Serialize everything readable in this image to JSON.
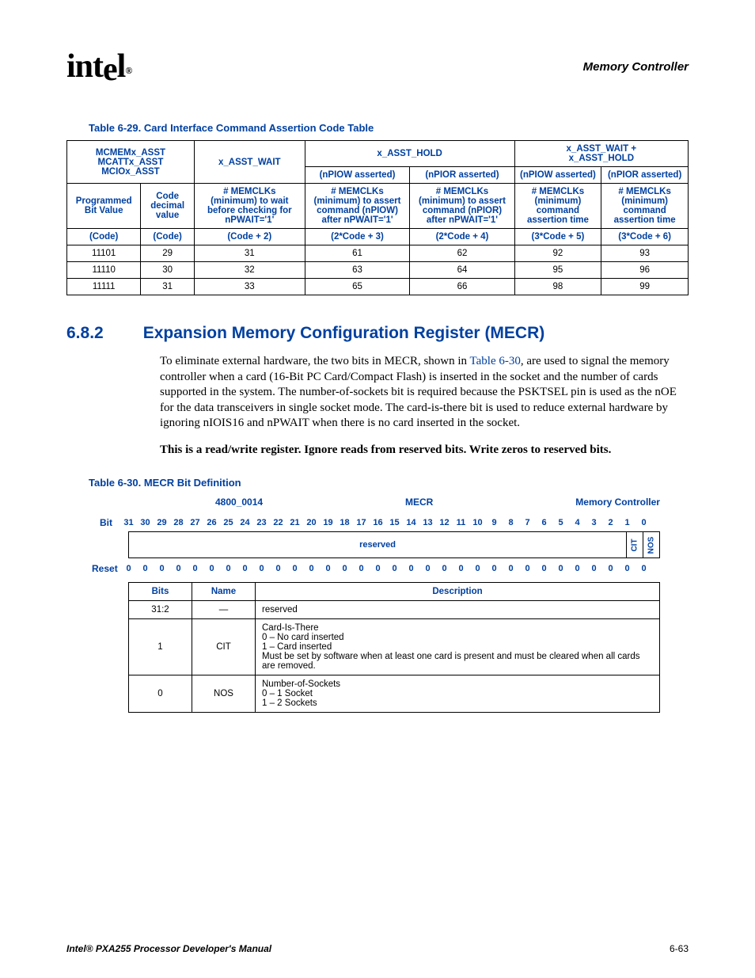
{
  "header": {
    "logo_text": "intel",
    "section_name": "Memory Controller"
  },
  "table629": {
    "caption": "Table 6-29. Card Interface Command Assertion Code Table",
    "grp1": "MCMEMx_ASST MCATTx_ASST MCIOx_ASST",
    "grp1a": "MCMEMx_ASST",
    "grp1b": "MCATTx_ASST",
    "grp1c": "MCIOx_ASST",
    "grp2": "x_ASST_WAIT",
    "grp3": "x_ASST_HOLD",
    "grp4a": "x_ASST_WAIT +",
    "grp4b": "x_ASST_HOLD",
    "sub_npiow": "(nPIOW asserted)",
    "sub_npior": "(nPIOR asserted)",
    "h_col1": "Programmed Bit Value",
    "h_col2": "Code decimal value",
    "h_col3": "# MEMCLKs (minimum) to wait before checking for nPWAIT='1'",
    "h_col4": "# MEMCLKs (minimum) to assert command (nPIOW) after nPWAIT='1'",
    "h_col5": "# MEMCLKs (minimum) to assert command (nPIOR) after nPWAIT='1'",
    "h_col6": "# MEMCLKs (minimum) command assertion time",
    "h_col7": "# MEMCLKs (minimum) command assertion time",
    "formula": [
      "(Code)",
      "(Code)",
      "(Code + 2)",
      "(2*Code + 3)",
      "(2*Code + 4)",
      "(3*Code + 5)",
      "(3*Code + 6)"
    ],
    "rows": [
      [
        "11101",
        "29",
        "31",
        "61",
        "62",
        "92",
        "93"
      ],
      [
        "11110",
        "30",
        "32",
        "63",
        "64",
        "95",
        "96"
      ],
      [
        "11111",
        "31",
        "33",
        "65",
        "66",
        "98",
        "99"
      ]
    ]
  },
  "section": {
    "num": "6.8.2",
    "title": "Expansion Memory Configuration Register (MECR)",
    "para1_a": "To eliminate external hardware, the two bits in MECR, shown in ",
    "para1_link": "Table 6-30",
    "para1_b": ", are used to signal the memory controller when a card (16-Bit PC Card/Compact Flash) is inserted in the socket and the number of cards supported in the system. The number-of-sockets bit is required because the PSKTSEL pin is used as the nOE for the data transceivers in single socket mode. The card-is-there bit is used to reduce external hardware by ignoring nIOIS16 and nPWAIT when there is no card inserted in the socket.",
    "para2": "This is a read/write register. Ignore reads from reserved bits. Write zeros to reserved bits."
  },
  "table630": {
    "caption": "Table 6-30. MECR Bit Definition",
    "addr": "4800_0014",
    "name": "MECR",
    "owner": "Memory Controller",
    "bit_label": "Bit",
    "reset_label": "Reset",
    "bits": [
      "31",
      "30",
      "29",
      "28",
      "27",
      "26",
      "25",
      "24",
      "23",
      "22",
      "21",
      "20",
      "19",
      "18",
      "17",
      "16",
      "15",
      "14",
      "13",
      "12",
      "11",
      "10",
      "9",
      "8",
      "7",
      "6",
      "5",
      "4",
      "3",
      "2",
      "1",
      "0"
    ],
    "field_reserved": "reserved",
    "field_cit": "CIT",
    "field_nos": "NOS",
    "resets": [
      "0",
      "0",
      "0",
      "0",
      "0",
      "0",
      "0",
      "0",
      "0",
      "0",
      "0",
      "0",
      "0",
      "0",
      "0",
      "0",
      "0",
      "0",
      "0",
      "0",
      "0",
      "0",
      "0",
      "0",
      "0",
      "0",
      "0",
      "0",
      "0",
      "0",
      "0",
      "0"
    ],
    "h_bits": "Bits",
    "h_name": "Name",
    "h_desc": "Description",
    "r1_bits": "31:2",
    "r1_name": "—",
    "r1_desc": "reserved",
    "r2_bits": "1",
    "r2_name": "CIT",
    "r2_l1": "Card-Is-There",
    "r2_l2": "0 –   No card inserted",
    "r2_l3": "1 –   Card inserted",
    "r2_l4": "Must be set by software when at least one card is present and must be cleared when all cards are removed.",
    "r3_bits": "0",
    "r3_name": "NOS",
    "r3_l1": "Number-of-Sockets",
    "r3_l2": "0 –   1 Socket",
    "r3_l3": "1 –   2 Sockets"
  },
  "footer": {
    "left": "Intel® PXA255 Processor Developer's Manual",
    "right": "6-63"
  }
}
